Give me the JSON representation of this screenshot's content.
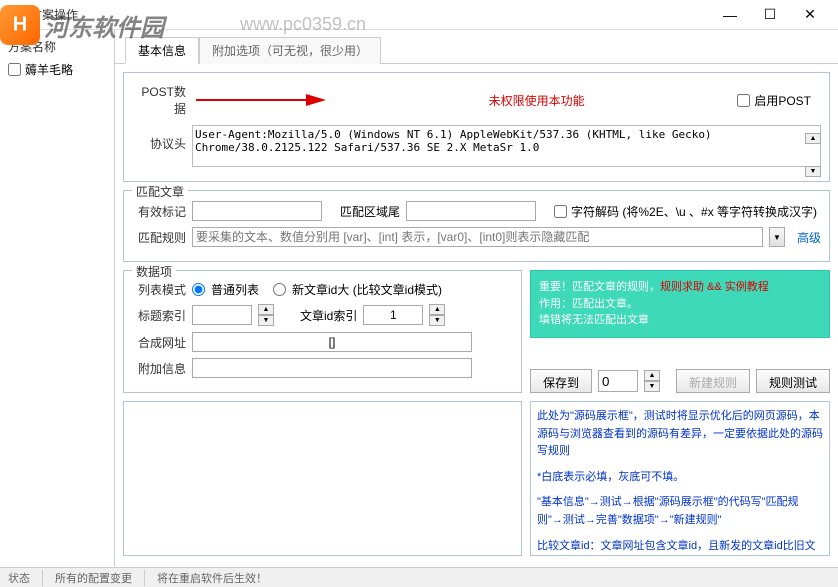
{
  "window": {
    "title": "方案操作"
  },
  "watermark": {
    "text": "河东软件园",
    "url": "www.pc0359.cn"
  },
  "sidebar": {
    "header": "方案名称",
    "items": [
      {
        "label": "薅羊毛略",
        "checked": false
      }
    ]
  },
  "tabs": [
    {
      "label": "基本信息",
      "active": true
    },
    {
      "label": "附加选项（可无视，很少用）",
      "active": false
    }
  ],
  "post": {
    "label": "POST数据",
    "unauth": "未权限使用本功能",
    "enable_label": "启用POST",
    "enable_checked": false
  },
  "protocol": {
    "label": "协议头",
    "value": "User-Agent:Mozilla/5.0 (Windows NT 6.1) AppleWebKit/537.36 (KHTML, like Gecko) Chrome/38.0.2125.122 Safari/537.36 SE 2.X MetaSr 1.0"
  },
  "match": {
    "group_label": "匹配文章",
    "valid_label": "有效标记",
    "valid_value": "",
    "area_tail_label": "匹配区域尾",
    "area_tail_value": "",
    "decode_label": "字符解码 (将%2E、\\u 、#x 等字符转换成汉字)",
    "decode_checked": false,
    "rule_label": "匹配规则",
    "rule_placeholder": "要采集的文本、数值分别用 [var]、[int] 表示，[var0]、[int0]则表示隐藏匹配",
    "advanced_link": "高级"
  },
  "dataitem": {
    "group_label": "数据项",
    "list_mode_label": "列表模式",
    "radio_normal": "普通列表",
    "radio_newid": "新文章id大 (比较文章id模式)",
    "radio_value": "normal",
    "title_idx_label": "标题索引",
    "title_idx_value": "",
    "article_idx_label": "文章id索引",
    "article_idx_value": "1",
    "synth_url_label": "合成网址",
    "synth_url_value": "[]",
    "extra_label": "附加信息",
    "extra_value": ""
  },
  "tip": {
    "line1_a": "重要！匹配文章的规则，",
    "line1_b": "规则求助 && 实例教程",
    "line2": "作用：匹配出文章。",
    "line3": "填错将无法匹配出文章"
  },
  "buttons": {
    "save_to": "保存到",
    "save_idx": "0",
    "new_rule": "新建规则",
    "test_rule": "规则测试"
  },
  "help": {
    "p1": "此处为\"源码展示框\"，测试时将显示优化后的网页源码，本源码与浏览器查看到的源码有差异，一定要依据此处的源码写规则",
    "p2": "*白底表示必填，灰底可不填。",
    "p3": "\"基本信息\"→测试→根据\"源码展示框\"的代码写\"匹配规则\"→测试→完善\"数据项\"→\"新建规则\"",
    "p4": "比较文章id：文章网址包含文章id，且新发的文章id比旧文章id大。—些论坛/博客推荐此模式。如果搞不清，直接用普通列表模式"
  },
  "statusbar": {
    "s1": "状态",
    "s2": "所有的配置变更",
    "s3": "将在重启软件后生效！"
  }
}
